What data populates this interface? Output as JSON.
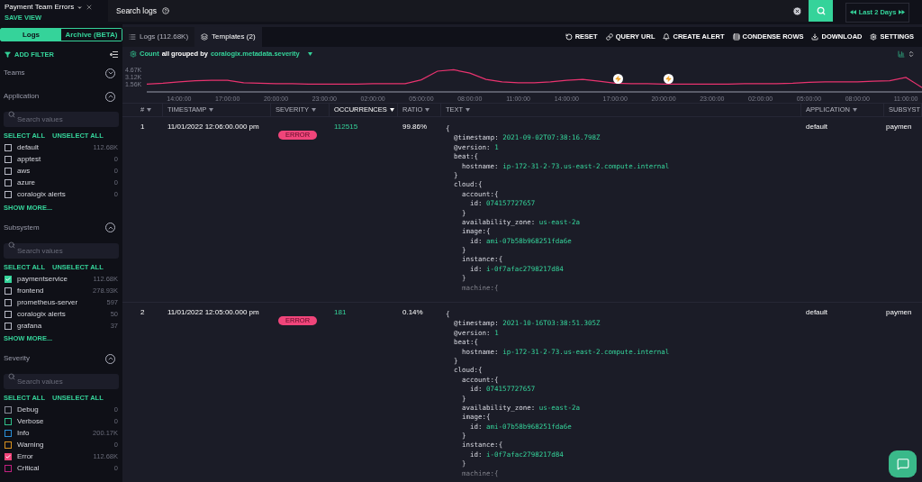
{
  "view": {
    "title": "Payment Team Errors",
    "save_label": "SAVE VIEW"
  },
  "search": {
    "placeholder": "Search logs"
  },
  "time_range": {
    "label": "Last 2 Days"
  },
  "mode_tabs": [
    {
      "label": "Logs",
      "selected": true
    },
    {
      "label": "Archive (BETA)",
      "selected": false
    }
  ],
  "add_filter": "ADD FILTER",
  "filters": [
    {
      "title": "Teams",
      "expanded": false
    },
    {
      "title": "Application",
      "expanded": true,
      "search_placeholder": "Search values",
      "select_all": "SELECT ALL",
      "unselect_all": "UNSELECT ALL",
      "show_more": "SHOW MORE...",
      "items": [
        {
          "label": "default",
          "count": "112.68K",
          "checked": false
        },
        {
          "label": "apptest",
          "count": "0",
          "checked": false
        },
        {
          "label": "aws",
          "count": "0",
          "checked": false
        },
        {
          "label": "azure",
          "count": "0",
          "checked": false
        },
        {
          "label": "coralogix alerts",
          "count": "0",
          "checked": false
        }
      ]
    },
    {
      "title": "Subsystem",
      "expanded": true,
      "search_placeholder": "Search values",
      "select_all": "SELECT ALL",
      "unselect_all": "UNSELECT ALL",
      "show_more": "SHOW MORE...",
      "items": [
        {
          "label": "paymentservice",
          "count": "112.68K",
          "checked": true
        },
        {
          "label": "frontend",
          "count": "278.93K",
          "checked": false
        },
        {
          "label": "prometheus-server",
          "count": "597",
          "checked": false
        },
        {
          "label": "coralogix alerts",
          "count": "50",
          "checked": false
        },
        {
          "label": "grafana",
          "count": "37",
          "checked": false
        }
      ]
    },
    {
      "title": "Severity",
      "expanded": true,
      "search_placeholder": "Search values",
      "select_all": "SELECT ALL",
      "unselect_all": "UNSELECT ALL",
      "items": [
        {
          "label": "Debug",
          "count": "0",
          "checked": false,
          "color": "#8a8c99"
        },
        {
          "label": "Verbose",
          "count": "0",
          "checked": false,
          "color": "#2fbf8a"
        },
        {
          "label": "Info",
          "count": "200.17K",
          "checked": false,
          "color": "#2a8fd8"
        },
        {
          "label": "Warning",
          "count": "0",
          "checked": false,
          "color": "#d9921f"
        },
        {
          "label": "Error",
          "count": "112.68K",
          "checked": true,
          "color": "#f0457a"
        },
        {
          "label": "Critical",
          "count": "0",
          "checked": false,
          "color": "#c0207f"
        }
      ]
    }
  ],
  "view_tabs": [
    {
      "label": "Logs (112.68K)",
      "selected": false
    },
    {
      "label": "Templates (2)",
      "selected": true
    }
  ],
  "toolbar": [
    "RESET",
    "QUERY URL",
    "CREATE ALERT",
    "CONDENSE ROWS",
    "DOWNLOAD",
    "SETTINGS"
  ],
  "chart_header": {
    "metric": "Count",
    "middle": "all grouped by",
    "field": "coralogix.metadata.severity"
  },
  "chart_data": {
    "type": "line",
    "ylim": [
      0,
      4.67
    ],
    "yticks": [
      {
        "value": 1.56,
        "label": "1.56K"
      },
      {
        "value": 3.12,
        "label": "3.12K"
      },
      {
        "value": 4.67,
        "label": "4.67K"
      }
    ],
    "categories": [
      null,
      null,
      "14:00:00",
      null,
      null,
      "17:00:00",
      null,
      null,
      "20:00:00",
      null,
      null,
      "23:00:00",
      null,
      null,
      "02:00:00",
      null,
      null,
      "05:00:00",
      null,
      null,
      "08:00:00",
      null,
      null,
      "11:00:00",
      null,
      null,
      "14:00:00",
      null,
      null,
      "17:00:00",
      null,
      null,
      "20:00:00",
      null,
      null,
      "23:00:00",
      null,
      null,
      "02:00:00",
      null,
      null,
      "05:00:00",
      null,
      null,
      "08:00:00",
      null,
      null,
      "11:00:00",
      null
    ],
    "series": [
      {
        "color": "#e8336f",
        "values": [
          1.6,
          1.8,
          2.1,
          2.3,
          2.4,
          2.4,
          1.9,
          1.8,
          1.7,
          1.7,
          1.6,
          1.6,
          1.6,
          1.6,
          1.7,
          1.7,
          1.7,
          2.5,
          4.3,
          4.6,
          3.9,
          2.6,
          2.1,
          1.9,
          1.9,
          2.1,
          2.4,
          2.6,
          2.2,
          1.8,
          1.7,
          1.7,
          1.6,
          1.6,
          1.6,
          1.6,
          1.6,
          1.7,
          1.7,
          1.7,
          1.8,
          2.0,
          2.1,
          2.1,
          2.1,
          2.2,
          2.3,
          3.0,
          0.9
        ]
      }
    ]
  },
  "table": {
    "columns": [
      {
        "label": "#",
        "sorted": false
      },
      {
        "label": "TIMESTAMP",
        "sorted": false
      },
      {
        "label": "SEVERITY",
        "sorted": false
      },
      {
        "label": "OCCURRENCES",
        "sorted": true
      },
      {
        "label": "RATIO",
        "sorted": false
      },
      {
        "label": "TEXT",
        "sorted": false
      },
      {
        "label": "APPLICATION",
        "sorted": false
      },
      {
        "label": "SUBSYST",
        "sorted": false
      }
    ],
    "rows": [
      {
        "index": "1",
        "timestamp": "11/01/2022 12:06:00.000 pm",
        "severity": "ERROR",
        "occurrences": "112515",
        "ratio": "99.86%",
        "application": "default",
        "subsystem": "paymen",
        "text": {
          "key": "{",
          "children": [
            {
              "key": "@timestamp:",
              "value": "2021-09-02T07:38:16.798Z"
            },
            {
              "key": "@version:",
              "value": "1"
            },
            {
              "key": "beat:{",
              "close": "}",
              "children": [
                {
                  "key": "hostname:",
                  "value": "ip-172-31-2-73.us-east-2.compute.internal"
                }
              ]
            },
            {
              "key": "cloud:{",
              "children": [
                {
                  "key": "account:{",
                  "close": "}",
                  "children": [
                    {
                      "key": "id:",
                      "value": "074157727657"
                    }
                  ]
                },
                {
                  "key": "availability_zone:",
                  "value": "us-east-2a"
                },
                {
                  "key": "image:{",
                  "close": "}",
                  "children": [
                    {
                      "key": "id:",
                      "value": "ami-07b58b968251fda6e"
                    }
                  ]
                },
                {
                  "key": "instance:{",
                  "close": "}",
                  "children": [
                    {
                      "key": "id:",
                      "value": "i-0f7afac2798217d84"
                    }
                  ]
                },
                {
                  "key": "machine:{"
                }
              ]
            }
          ]
        }
      },
      {
        "index": "2",
        "timestamp": "11/01/2022 12:05:00.000 pm",
        "severity": "ERROR",
        "occurrences": "181",
        "ratio": "0.14%",
        "application": "default",
        "subsystem": "paymen",
        "text": {
          "key": "{",
          "children": [
            {
              "key": "@timestamp:",
              "value": "2021-10-16T03:38:51.305Z"
            },
            {
              "key": "@version:",
              "value": "1"
            },
            {
              "key": "beat:{",
              "close": "}",
              "children": [
                {
                  "key": "hostname:",
                  "value": "ip-172-31-2-73.us-east-2.compute.internal"
                }
              ]
            },
            {
              "key": "cloud:{",
              "children": [
                {
                  "key": "account:{",
                  "close": "}",
                  "children": [
                    {
                      "key": "id:",
                      "value": "074157727657"
                    }
                  ]
                },
                {
                  "key": "availability_zone:",
                  "value": "us-east-2a"
                },
                {
                  "key": "image:{",
                  "close": "}",
                  "children": [
                    {
                      "key": "id:",
                      "value": "ami-07b58b968251fda6e"
                    }
                  ]
                },
                {
                  "key": "instance:{",
                  "close": "}",
                  "children": [
                    {
                      "key": "id:",
                      "value": "i-0f7afac2798217d84"
                    }
                  ]
                },
                {
                  "key": "machine:{"
                }
              ]
            }
          ]
        }
      }
    ]
  }
}
